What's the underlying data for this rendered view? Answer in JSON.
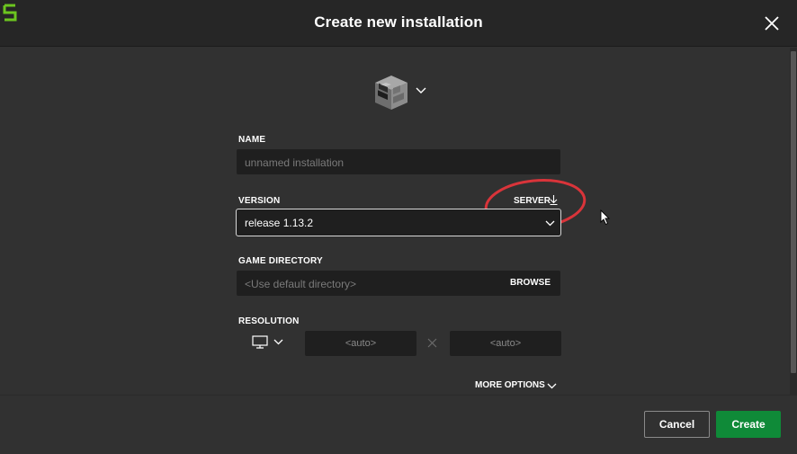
{
  "header": {
    "title": "Create new installation",
    "logo_icon": "launcher-logo-icon",
    "close_icon": "close-icon"
  },
  "icon_picker": {
    "icon": "furnace-block-icon",
    "chevron": "chevron-down-icon"
  },
  "form": {
    "name": {
      "label": "NAME",
      "value": "",
      "placeholder": "unnamed installation"
    },
    "version": {
      "label": "VERSION",
      "selected": "release 1.13.2",
      "server_label": "SERVER",
      "server_icon": "download-icon"
    },
    "game_directory": {
      "label": "GAME DIRECTORY",
      "placeholder": "<Use default directory>",
      "browse_label": "BROWSE"
    },
    "resolution": {
      "label": "RESOLUTION",
      "monitor_icon": "monitor-icon",
      "width_value": "<auto>",
      "height_value": "<auto>",
      "separator_icon": "times-icon"
    },
    "more_options_label": "MORE OPTIONS"
  },
  "footer": {
    "cancel_label": "Cancel",
    "create_label": "Create"
  },
  "colors": {
    "background": "#313131",
    "titlebar": "#262626",
    "field": "#1f1f1f",
    "accent_green": "#0f8a38",
    "logo_green": "#6cc51f",
    "annotation_red": "#d9343a"
  }
}
